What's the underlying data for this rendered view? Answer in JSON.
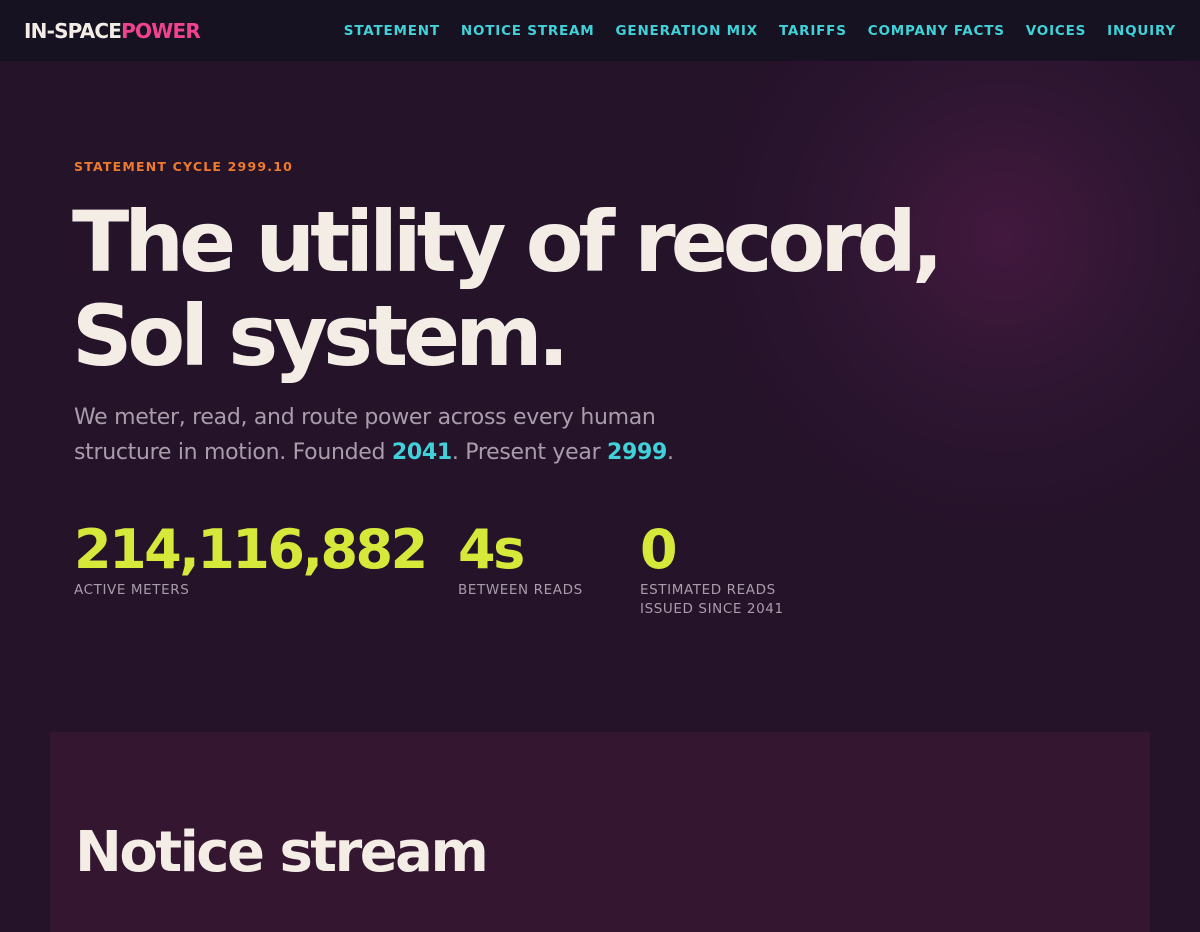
{
  "header": {
    "logo_left": "IN-SPACE",
    "logo_right": "POWER",
    "nav": [
      {
        "label": "STATEMENT"
      },
      {
        "label": "NOTICE STREAM"
      },
      {
        "label": "GENERATION MIX"
      },
      {
        "label": "TARIFFS"
      },
      {
        "label": "COMPANY FACTS"
      },
      {
        "label": "VOICES"
      },
      {
        "label": "INQUIRY"
      }
    ]
  },
  "hero": {
    "eyebrow": "STATEMENT CYCLE 2999.10",
    "headline_line1": "The utility of record,",
    "headline_line2": "Sol system.",
    "lede_part1": "We meter, read, and route power across every human structure in motion. Founded ",
    "founded_year": "2041",
    "lede_part2": ". Present year ",
    "present_year": "2999",
    "lede_part3": ".",
    "stats": [
      {
        "value": "214,116,882",
        "label": "ACTIVE METERS"
      },
      {
        "value": "4s",
        "label": "BETWEEN READS"
      },
      {
        "value": "0",
        "label_line1": "ESTIMATED READS",
        "label_line2": "ISSUED SINCE 2041"
      }
    ]
  },
  "notice_stream": {
    "title": "Notice stream"
  },
  "colors": {
    "background": "#25132a",
    "topbar": "#171222",
    "accent_cyan": "#40d2d8",
    "accent_pink": "#f0428f",
    "accent_orange": "#f07a2b",
    "accent_lime": "#d6e83a",
    "text_light": "#f3ede6",
    "text_muted": "#a99cab",
    "panel": "#351631"
  }
}
